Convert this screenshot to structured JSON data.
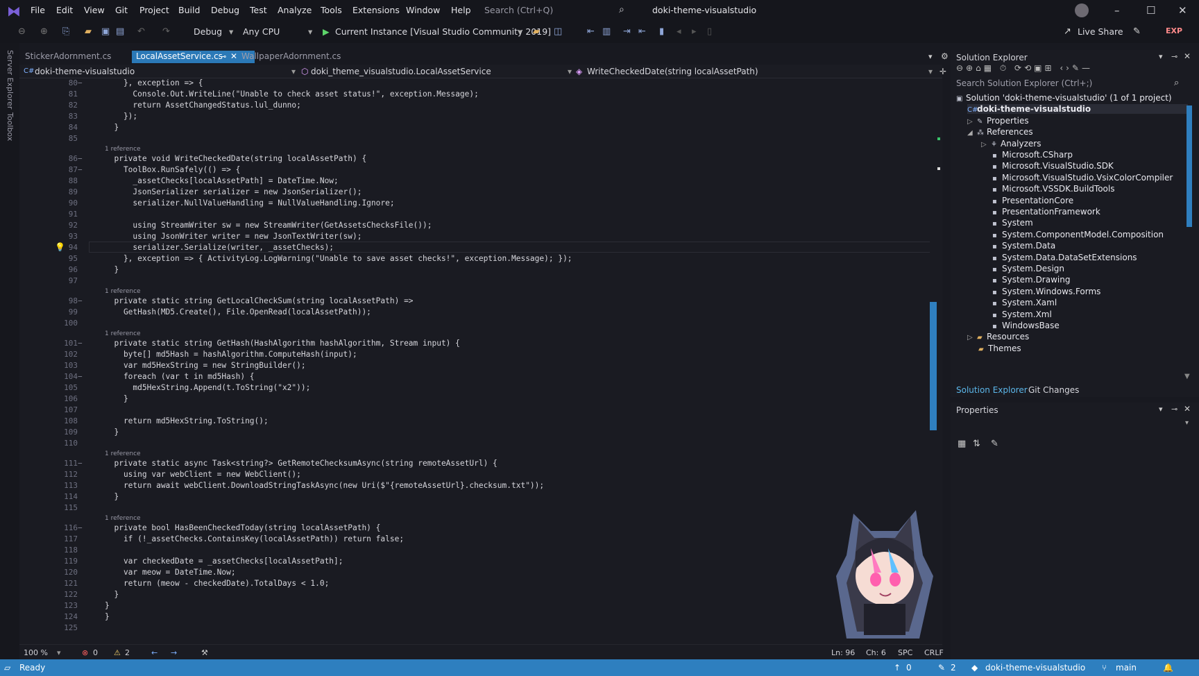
{
  "titlebar": {
    "menu": [
      "File",
      "Edit",
      "View",
      "Git",
      "Project",
      "Build",
      "Debug",
      "Test",
      "Analyze",
      "Tools",
      "Extensions",
      "Window",
      "Help"
    ],
    "search_placeholder": "Search (Ctrl+Q)",
    "window_title": "doki-theme-visualstudio"
  },
  "toolbar": {
    "config": "Debug",
    "platform": "Any CPU",
    "run_label": "Current Instance [Visual Studio Community 2019]",
    "live_share": "Live Share",
    "exp": "EXP"
  },
  "left_strip": {
    "server_explorer": "Server Explorer",
    "toolbox": "Toolbox"
  },
  "tabs": [
    {
      "label": "StickerAdornment.cs",
      "active": false
    },
    {
      "label": "LocalAssetService.cs",
      "active": true
    },
    {
      "label": "WallpaperAdornment.cs",
      "active": false
    }
  ],
  "navbar": {
    "project": "doki-theme-visualstudio",
    "class": "doki_theme_visualstudio.LocalAssetService",
    "member": "WriteCheckedDate(string localAssetPath)"
  },
  "code_lines": [
    {
      "n": "80",
      "t": "    }, exception => {"
    },
    {
      "n": "81",
      "t": "      Console.Out.WriteLine(\"Unable to check asset status!\", exception.Message);"
    },
    {
      "n": "82",
      "t": "      return AssetChangedStatus.lul_dunno;"
    },
    {
      "n": "83",
      "t": "    });"
    },
    {
      "n": "84",
      "t": "  }"
    },
    {
      "n": "85",
      "t": ""
    },
    {
      "n": "86",
      "t": "  private void WriteCheckedDate(string localAssetPath) {"
    },
    {
      "n": "87",
      "t": "    ToolBox.RunSafely(() => {"
    },
    {
      "n": "88",
      "t": "      _assetChecks[localAssetPath] = DateTime.Now;"
    },
    {
      "n": "89",
      "t": "      JsonSerializer serializer = new JsonSerializer();"
    },
    {
      "n": "90",
      "t": "      serializer.NullValueHandling = NullValueHandling.Ignore;"
    },
    {
      "n": "91",
      "t": ""
    },
    {
      "n": "92",
      "t": "      using StreamWriter sw = new StreamWriter(GetAssetsChecksFile());"
    },
    {
      "n": "93",
      "t": "      using JsonWriter writer = new JsonTextWriter(sw);"
    },
    {
      "n": "94",
      "t": "      serializer.Serialize(writer, _assetChecks);"
    },
    {
      "n": "95",
      "t": "    }, exception => { ActivityLog.LogWarning(\"Unable to save asset checks!\", exception.Message); });"
    },
    {
      "n": "96",
      "t": "  }"
    },
    {
      "n": "97",
      "t": ""
    },
    {
      "n": "98",
      "t": "  private static string GetLocalCheckSum(string localAssetPath) =>"
    },
    {
      "n": "99",
      "t": "    GetHash(MD5.Create(), File.OpenRead(localAssetPath));"
    },
    {
      "n": "100",
      "t": ""
    },
    {
      "n": "101",
      "t": "  private static string GetHash(HashAlgorithm hashAlgorithm, Stream input) {"
    },
    {
      "n": "102",
      "t": "    byte[] md5Hash = hashAlgorithm.ComputeHash(input);"
    },
    {
      "n": "103",
      "t": "    var md5HexString = new StringBuilder();"
    },
    {
      "n": "104",
      "t": "    foreach (var t in md5Hash) {"
    },
    {
      "n": "105",
      "t": "      md5HexString.Append(t.ToString(\"x2\"));"
    },
    {
      "n": "106",
      "t": "    }"
    },
    {
      "n": "107",
      "t": ""
    },
    {
      "n": "108",
      "t": "    return md5HexString.ToString();"
    },
    {
      "n": "109",
      "t": "  }"
    },
    {
      "n": "110",
      "t": ""
    },
    {
      "n": "111",
      "t": "  private static async Task<string?> GetRemoteChecksumAsync(string remoteAssetUrl) {"
    },
    {
      "n": "112",
      "t": "    using var webClient = new WebClient();"
    },
    {
      "n": "113",
      "t": "    return await webClient.DownloadStringTaskAsync(new Uri($\"{remoteAssetUrl}.checksum.txt\"));"
    },
    {
      "n": "114",
      "t": "  }"
    },
    {
      "n": "115",
      "t": ""
    },
    {
      "n": "116",
      "t": "  private bool HasBeenCheckedToday(string localAssetPath) {"
    },
    {
      "n": "117",
      "t": "    if (!_assetChecks.ContainsKey(localAssetPath)) return false;"
    },
    {
      "n": "118",
      "t": ""
    },
    {
      "n": "119",
      "t": "    var checkedDate = _assetChecks[localAssetPath];"
    },
    {
      "n": "120",
      "t": "    var meow = DateTime.Now;"
    },
    {
      "n": "121",
      "t": "    return (meow - checkedDate).TotalDays < 1.0;"
    },
    {
      "n": "122",
      "t": "  }"
    },
    {
      "n": "123",
      "t": "}"
    },
    {
      "n": "124",
      "t": "}"
    },
    {
      "n": "125",
      "t": ""
    }
  ],
  "reference_label": "1 reference",
  "editor_status": {
    "zoom": "100 %",
    "errors": "0",
    "warnings": "2",
    "line": "Ln: 96",
    "col": "Ch: 6",
    "spc": "SPC",
    "crlf": "CRLF"
  },
  "solution_explorer": {
    "title": "Solution Explorer",
    "search_placeholder": "Search Solution Explorer (Ctrl+;)",
    "solution": "Solution 'doki-theme-visualstudio' (1 of 1 project)",
    "project": "doki-theme-visualstudio",
    "properties": "Properties",
    "references": "References",
    "refs": [
      "Analyzers",
      "Microsoft.CSharp",
      "Microsoft.VisualStudio.SDK",
      "Microsoft.VisualStudio.VsixColorCompiler",
      "Microsoft.VSSDK.BuildTools",
      "PresentationCore",
      "PresentationFramework",
      "System",
      "System.ComponentModel.Composition",
      "System.Data",
      "System.Data.DataSetExtensions",
      "System.Design",
      "System.Drawing",
      "System.Windows.Forms",
      "System.Xaml",
      "System.Xml",
      "WindowsBase"
    ],
    "resources": "Resources",
    "themes": "Themes",
    "tab1": "Solution Explorer",
    "tab2": "Git Changes"
  },
  "properties_panel": {
    "title": "Properties"
  },
  "bottom_bar": {
    "ready": "Ready",
    "up_count": "0",
    "edit_count": "2",
    "repo": "doki-theme-visualstudio",
    "branch": "main"
  },
  "colors": {
    "accent": "#2b79b7",
    "statusbar": "#2e7fbf",
    "background": "#1a1b22"
  }
}
